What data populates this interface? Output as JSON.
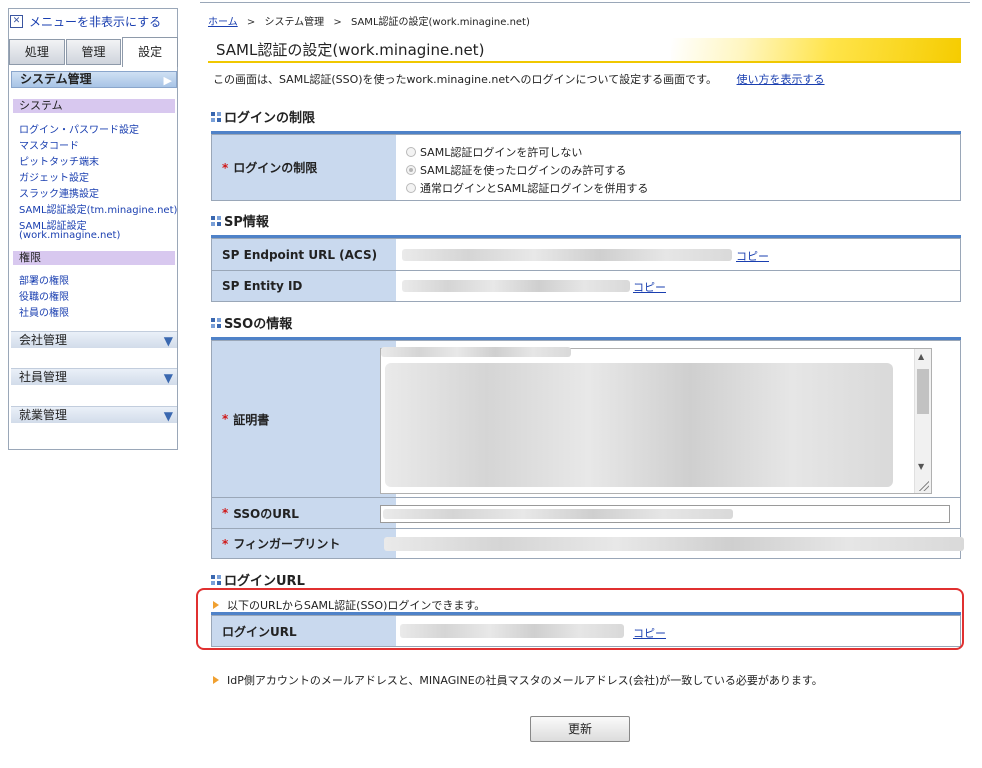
{
  "sidebar": {
    "hide_menu_icon": "close-box-icon",
    "hide_menu_label": "メニューを非表示にする",
    "tabs": [
      {
        "label": "処理"
      },
      {
        "label": "管理"
      },
      {
        "label": "設定"
      }
    ],
    "active_tab": "設定",
    "section_title": "システム管理",
    "system_group": {
      "title": "システム",
      "items": [
        "ログイン・パスワード設定",
        "マスタコード",
        "ピットタッチ端末",
        "ガジェット設定",
        "スラック連携設定",
        "SAML認証設定(tm.minagine.net)",
        "SAML認証設定",
        "(work.minagine.net)"
      ]
    },
    "rights_group": {
      "title": "権限",
      "items": [
        "部署の権限",
        "役職の権限",
        "社員の権限"
      ]
    },
    "collapsed_groups": [
      "会社管理",
      "社員管理",
      "就業管理"
    ]
  },
  "breadcrumb": {
    "home": "ホーム",
    "separator": ">",
    "level1": "システム管理",
    "current": "SAML認証の設定(work.minagine.net)"
  },
  "page": {
    "title": "SAML認証の設定(work.minagine.net)",
    "intro": "この画面は、SAML認証(SSO)を使ったwork.minagine.netへのログインについて設定する画面です。",
    "help_link": "使い方を表示する"
  },
  "login_restriction": {
    "section_title": "ログインの制限",
    "required_mark": "*",
    "label": "ログインの制限",
    "options": [
      "SAML認証ログインを許可しない",
      "SAML認証を使ったログインのみ許可する",
      "通常ログインとSAML認証ログインを併用する"
    ],
    "selected_index": 1
  },
  "sp_info": {
    "section_title": "SP情報",
    "endpoint_label": "SP Endpoint URL (ACS)",
    "entity_label": "SP Entity ID",
    "copy_label": "コピー"
  },
  "sso_info": {
    "section_title": "SSOの情報",
    "required_mark": "*",
    "certificate_label": "証明書",
    "sso_url_label": "SSOのURL",
    "fingerprint_label": "フィンガープリント"
  },
  "login_url": {
    "section_title": "ログインURL",
    "notice": "以下のURLからSAML認証(SSO)ログインできます。",
    "label": "ログインURL",
    "copy_label": "コピー"
  },
  "footer_note": "IdP側アカウントのメールアドレスと、MINAGINEの社員マスタのメールアドレス(会社)が一致している必要があります。",
  "update_button": "更新",
  "colors": {
    "accent_yellow": "#f5cc00",
    "header_blue": "#4f82c8",
    "label_bg": "#c9d9ee",
    "required_red": "#d01818",
    "highlight_box": "#e03030"
  }
}
